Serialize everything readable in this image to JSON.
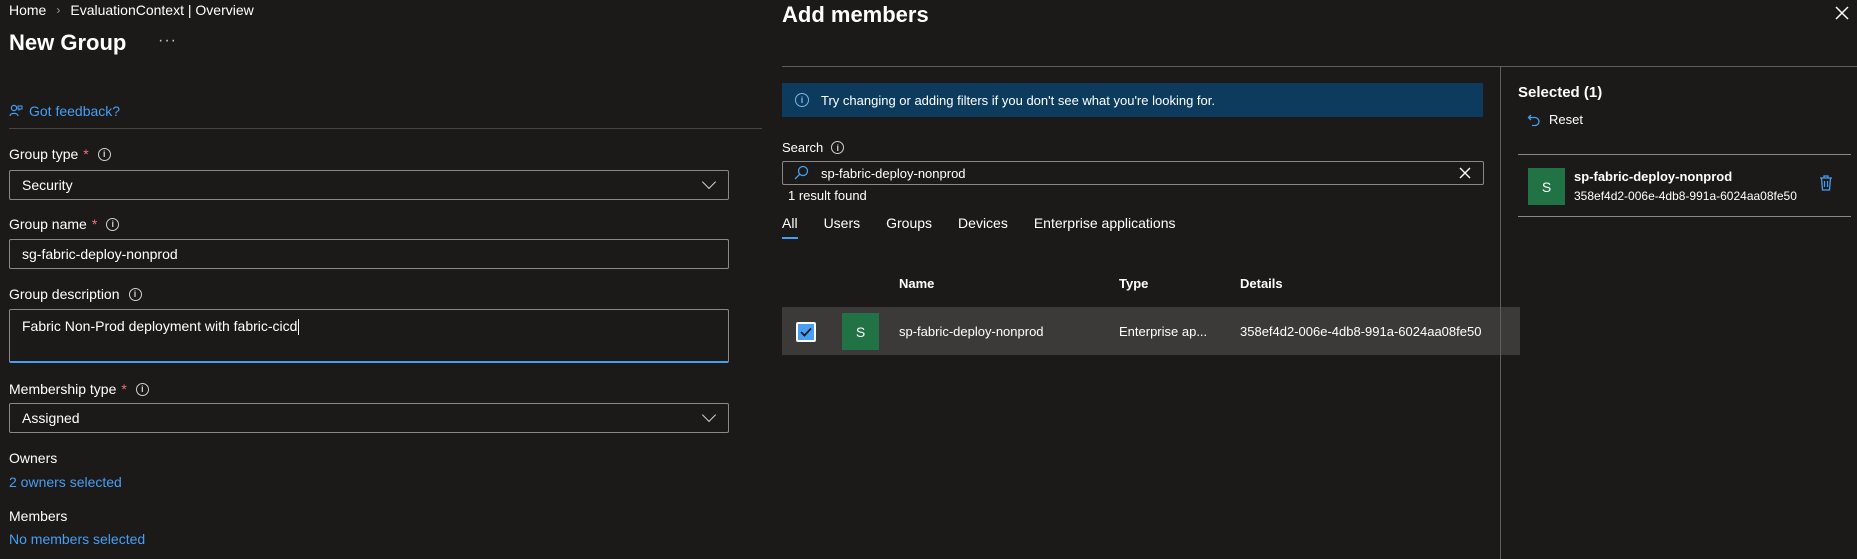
{
  "breadcrumb": {
    "home": "Home",
    "context": "EvaluationContext | Overview",
    "separator": "›"
  },
  "page": {
    "title": "New Group",
    "more": "···",
    "feedback": "Got feedback?"
  },
  "form": {
    "group_type": {
      "label": "Group type",
      "required": "*",
      "value": "Security"
    },
    "group_name": {
      "label": "Group name",
      "required": "*",
      "value": "sg-fabric-deploy-nonprod"
    },
    "group_description": {
      "label": "Group description",
      "value": "Fabric Non-Prod deployment with fabric-cicd"
    },
    "membership_type": {
      "label": "Membership type",
      "required": "*",
      "value": "Assigned"
    },
    "owners": {
      "label": "Owners",
      "link": "2 owners selected"
    },
    "members": {
      "label": "Members",
      "link": "No members selected"
    }
  },
  "add_members": {
    "title": "Add members",
    "banner": "Try changing or adding filters if you don't see what you're looking for.",
    "search": {
      "label": "Search",
      "value": "sp-fabric-deploy-nonprod",
      "result_count": "1 result found"
    },
    "tabs": [
      {
        "label": "All",
        "active": true
      },
      {
        "label": "Users"
      },
      {
        "label": "Groups"
      },
      {
        "label": "Devices"
      },
      {
        "label": "Enterprise applications"
      }
    ],
    "columns": {
      "name": "Name",
      "type": "Type",
      "details": "Details"
    },
    "rows": [
      {
        "checked": true,
        "avatar": "S",
        "name": "sp-fabric-deploy-nonprod",
        "type": "Enterprise ap...",
        "details": "358ef4d2-006e-4db8-991a-6024aa08fe50"
      }
    ],
    "selected": {
      "title": "Selected (1)",
      "reset": "Reset",
      "items": [
        {
          "avatar": "S",
          "name": "sp-fabric-deploy-nonprod",
          "details": "358ef4d2-006e-4db8-991a-6024aa08fe50"
        }
      ]
    }
  },
  "icons": {
    "feedback": "feedback-person-icon",
    "info": "info-icon",
    "chevron": "chevron-down-icon",
    "search": "search-icon",
    "clear": "dismiss-icon",
    "close": "close-icon",
    "reset": "undo-icon",
    "delete": "trash-icon",
    "check": "checkmark-icon"
  },
  "colors": {
    "accent": "#479ef5",
    "required": "#f1707b",
    "avatar_bg": "#217346",
    "banner_bg": "#0c3b5e",
    "background": "#1b1a19"
  }
}
